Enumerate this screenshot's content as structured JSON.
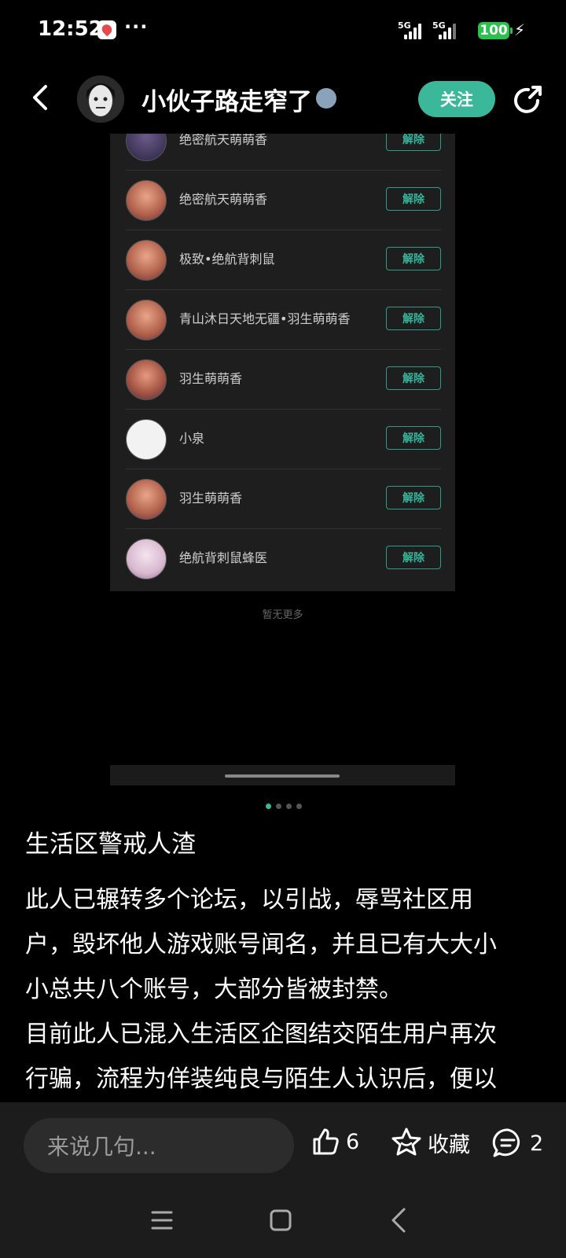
{
  "status_bar": {
    "time": "12:52",
    "dots": "···",
    "sig1": "5G",
    "sig2": "5G",
    "battery": "100"
  },
  "header": {
    "username": "小伙子路走窄了",
    "follow_label": "关注"
  },
  "blocklist": {
    "items": [
      {
        "name": "绝密航天萌萌香",
        "action": "解除"
      },
      {
        "name": "绝密航天萌萌香",
        "action": "解除"
      },
      {
        "name": "极致•绝航背刺鼠",
        "action": "解除"
      },
      {
        "name": "青山沐日天地无疆•羽生萌萌香",
        "action": "解除"
      },
      {
        "name": "羽生萌萌香",
        "action": "解除"
      },
      {
        "name": "小泉",
        "action": "解除"
      },
      {
        "name": "羽生萌萌香",
        "action": "解除"
      },
      {
        "name": "绝航背刺鼠蜂医",
        "action": "解除"
      }
    ],
    "no_more": "暂无更多"
  },
  "pager": {
    "total": 4,
    "current": 1
  },
  "post": {
    "title": "生活区警戒人渣",
    "line1": "此人已辗转多个论坛，以引战，辱骂社区用",
    "line2": "户，毁坏他人游戏账号闻名，并且已有大大小",
    "line3": "小总共八个账号，大部分皆被封禁。",
    "line4": "目前此人已混入生活区企图结交陌生用户再次",
    "line5": "行骗，流程为佯装纯良与陌生人认识后，便以"
  },
  "actions": {
    "comment_placeholder": "来说几句...",
    "like_count": "6",
    "collect_label": "收藏",
    "comment_count": "2"
  },
  "colors": {
    "accent": "#3bb89a",
    "background": "#000000",
    "bar": "#1c1c1c"
  }
}
